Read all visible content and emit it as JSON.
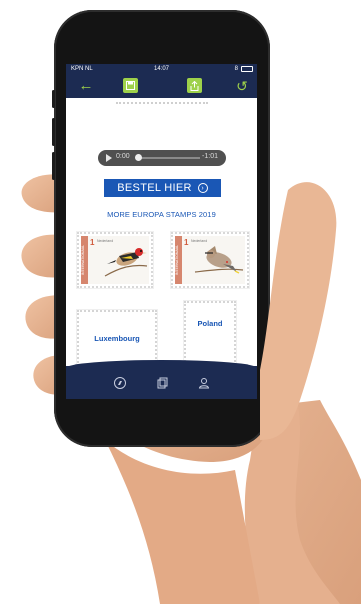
{
  "status_bar": {
    "carrier": "KPN NL",
    "time": "14:07",
    "right": "8"
  },
  "audio": {
    "current": "0:00",
    "remaining": "-1:01"
  },
  "cta_label": "BESTEL HIER",
  "section_title": "MORE EUROPA STAMPS 2019",
  "stamps": [
    {
      "value": "1",
      "country": "Nederland",
      "side": "INTERNATIONAAL",
      "year": "2019"
    },
    {
      "value": "1",
      "country": "Nederland",
      "side": "INTERNATIONAAL",
      "year": "2019"
    }
  ],
  "countries": [
    "Luxembourg",
    "Poland"
  ],
  "colors": {
    "nav": "#1c2b52",
    "accent": "#9ed14a",
    "brand_blue": "#1a57b5"
  }
}
